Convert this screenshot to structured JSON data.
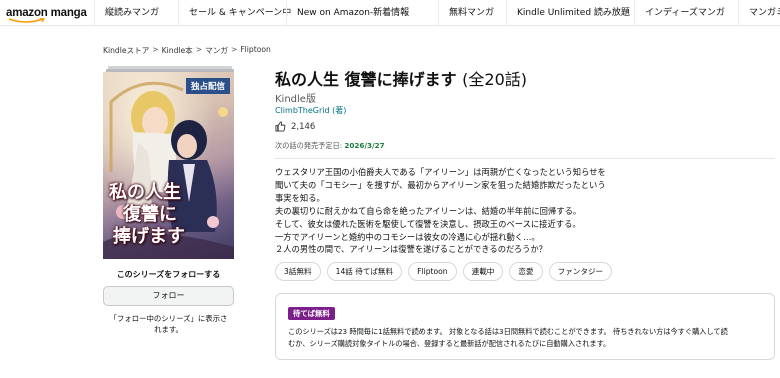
{
  "nav": {
    "logo": "amazon manga",
    "items": [
      "縦読みマンガ",
      "セール & キャンペーン中",
      "New on Amazon-新着情報",
      "無料マンガ",
      "Kindle Unlimited 読み放題",
      "インディーズマンガ",
      "マンガミックス"
    ]
  },
  "breadcrumb": [
    "Kindleストア",
    "Kindle本",
    "マンガ",
    "Fliptoon"
  ],
  "cover": {
    "badge": "独占配信",
    "title_line1": "私の人生",
    "title_line2": "復讐に",
    "title_line3": "捧げます",
    "colors": {
      "badge": "#2a4f8a",
      "title_outline": "#5b0d19"
    }
  },
  "follow": {
    "heading": "このシリーズをフォローする",
    "button": "フォロー",
    "note_line1": "「フォロー中のシリーズ」に表示さ",
    "note_line2": "れます。"
  },
  "product": {
    "title": "私の人生 復讐に捧げます",
    "count": "(全20話)",
    "format": "Kindle版",
    "author": "ClimbTheGrid (著)",
    "likes": "2,146",
    "next_label": "次の話の発売予定日:",
    "next_date": "2026/3/27",
    "description": [
      "ウェスタリア王国の小伯爵夫人である「アイリーン」は両親が亡くなったという知らせを",
      "聞いて夫の「コモシー」を捜すが、最初からアイリーン家を狙った結婚詐欺だったという",
      "事実を知る。",
      "夫の裏切りに耐えかねて自ら命を絶ったアイリーンは、結婚の半年前に回帰する。",
      "そして、彼女は優れた医術を駆使して復讐を決意し、摂政王のベースに接近する。",
      "一方でアイリーンと婚約中のコモシーは彼女の冷遇に心が揺れ動く…。",
      "２人の男性の間で、アイリーンは復讐を遂げることができるのだろうか？"
    ],
    "tags": [
      "3話無料",
      "14話 待てば無料",
      "Fliptoon",
      "連載中",
      "恋愛",
      "ファンタジー"
    ]
  },
  "free_box": {
    "badge": "待てば無料",
    "line1": "このシリーズは23 時間毎に1話無料で読めます。 対象となる話は3日間無料で読むことができます。 待ちきれない方は今すぐ購入して読",
    "line2": "むか、シリーズ購読対象タイトルの場合、登録すると最新話が配信されるたびに自動購入されます。"
  }
}
